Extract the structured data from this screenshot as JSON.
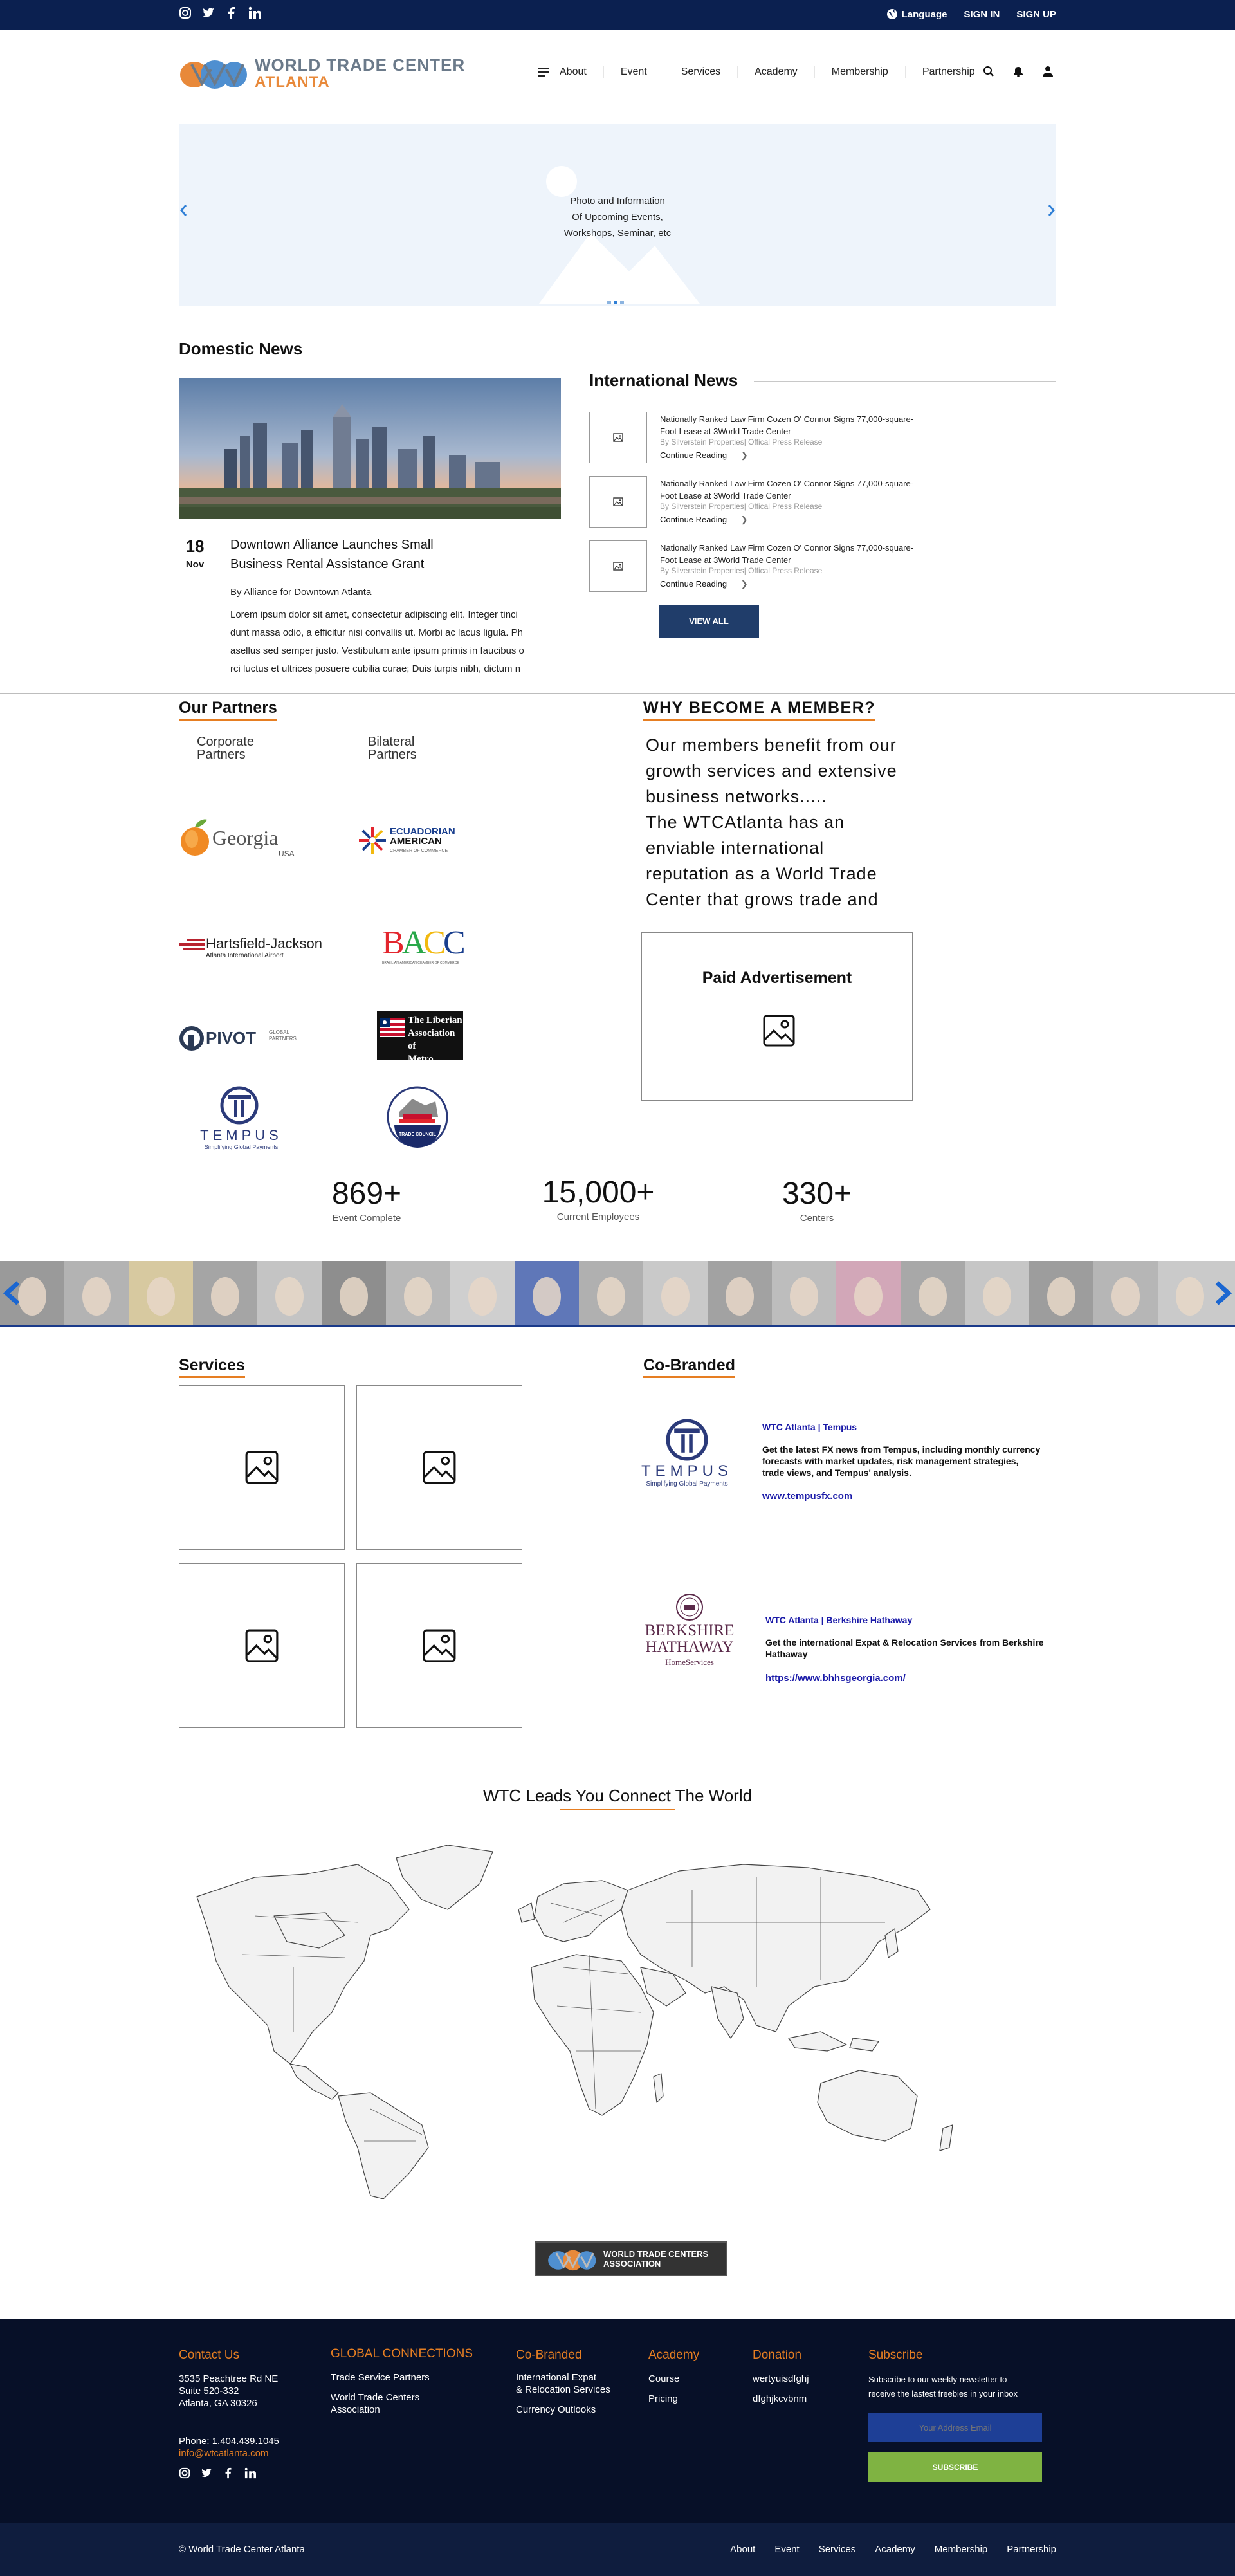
{
  "topbar": {
    "social": [
      "instagram-icon",
      "twitter-icon",
      "facebook-icon",
      "linkedin-icon"
    ],
    "language": "Language",
    "signin": "SIGN IN",
    "signup": "SIGN UP"
  },
  "brand": {
    "line1": "WORLD TRADE CENTER",
    "line2": "ATLANTA"
  },
  "nav": {
    "items": [
      "About",
      "Event",
      "Services",
      "Academy",
      "Membership",
      "Partnership"
    ]
  },
  "hero": {
    "line1": "Photo and Information",
    "line2": "Of Upcoming Events,",
    "line3": "Workshops, Seminar, etc"
  },
  "domestic": {
    "title": "Domestic News",
    "day": "18",
    "month": "Nov",
    "headline1": "Downtown Alliance Launches Small",
    "headline2": "Business Rental Assistance Grant",
    "author": "By Alliance for Downtown Atlanta",
    "body1": "Lorem ipsum dolor sit amet, consectetur adipiscing elit. Integer tinci",
    "body2": "dunt massa odio, a efficitur nisi convallis ut. Morbi ac lacus ligula. Ph",
    "body3": "asellus sed semper justo. Vestibulum ante ipsum primis in faucibus o",
    "body4": "rci luctus et ultrices posuere cubilia curae; Duis turpis nibh, dictum n"
  },
  "international": {
    "title": "International News",
    "items": [
      {
        "t1": "Nationally Ranked Law Firm Cozen O' Connor Signs 77,000-square-",
        "t2": "Foot Lease at 3World Trade Center",
        "src": "By Silverstein Properties|  Offical Press Release",
        "more": "Continue Reading"
      },
      {
        "t1": "Nationally Ranked Law Firm Cozen O' Connor Signs 77,000-square-",
        "t2": "Foot Lease at 3World Trade Center",
        "src": "By Silverstein Properties|  Offical Press Release",
        "more": "Continue Reading"
      },
      {
        "t1": "Nationally Ranked Law Firm Cozen O' Connor Signs 77,000-square-",
        "t2": "Foot Lease at 3World Trade Center",
        "src": "By Silverstein Properties|  Offical Press Release",
        "more": "Continue Reading"
      }
    ],
    "view_all": "VIEW ALL"
  },
  "partners": {
    "title": "Our Partners",
    "col1a": "Corporate",
    "col1b": "Partners",
    "col2a": "Bilateral",
    "col2b": "Partners",
    "logos": {
      "georgia": "Georgia",
      "georgia_sub": "USA",
      "ecuador1": "ECUADORIAN",
      "ecuador2": "AMERICAN",
      "ecuador3": "CHAMBER OF COMMERCE",
      "hartsfield1": "Hartsfield-Jackson",
      "hartsfield2": "Atlanta International Airport",
      "bacc": "BACC",
      "bacc_sub": "BRAZILIAN-AMERICAN CHAMBER OF COMMERCE",
      "pivot": "PIVOT",
      "pivot_sub": "GLOBAL PARTNERS",
      "liberian1": "The Liberian",
      "liberian2": "Association of",
      "liberian3": "Metro Atlanta",
      "tempus": "TEMPUS",
      "tempus_sub": "Simplifying Global Payments",
      "usa_council": "TRADE COUNCIL"
    }
  },
  "member": {
    "title": "WHY BECOME A MEMBER?",
    "lines": [
      "Our members benefit from our",
      "growth services and extensive",
      "business networks.....",
      "The WTCAtlanta has an",
      "enviable international",
      "reputation as a World Trade",
      "Center that grows trade and"
    ],
    "ad": "Paid Advertisement"
  },
  "stats": [
    {
      "num": "869+",
      "label": "Event Complete"
    },
    {
      "num": "15,000+",
      "label": "Current Employees"
    },
    {
      "num": "330+",
      "label": "Centers"
    }
  ],
  "services": {
    "title": "Services"
  },
  "cobranded": {
    "title": "Co-Branded",
    "items": [
      {
        "link": "WTC Atlanta | Tempus",
        "d1": "Get the latest FX news from Tempus, including monthly currency",
        "d2": "forecasts with market updates, risk management strategies,",
        "d3": "trade views, and Tempus' analysis.",
        "url": "www.tempusfx.com",
        "logo1": "TEMPUS",
        "logo2": "Simplifying Global Payments"
      },
      {
        "link": "WTC Atlanta | Berkshire Hathaway",
        "d1": "Get the international Expat & Relocation Services from Berkshire",
        "d2": "Hathaway",
        "d3": "",
        "url": "https://www.bhhsgeorgia.com/",
        "logo1": "BERKSHIRE",
        "logo2": "HATHAWAY",
        "logo3": "HomeServices"
      }
    ]
  },
  "world": {
    "title": "WTC Leads You Connect The World",
    "badge1": "WORLD TRADE CENTERS",
    "badge2": "ASSOCIATION"
  },
  "footer": {
    "contact": {
      "title": "Contact Us",
      "l1": "3535 Peachtree Rd NE",
      "l2": "Suite 520-332",
      "l3": "Atlanta, GA 30326",
      "phone": "Phone: 1.404.439.1045",
      "email": "info@wtcatlanta.com"
    },
    "global": {
      "title": "GLOBAL CONNECTIONS",
      "i1": "Trade Service Partners",
      "i2a": "World Trade Centers",
      "i2b": "Association"
    },
    "cob": {
      "title": "Co-Branded",
      "i1a": "International Expat",
      "i1b": "& Relocation Services",
      "i2": "Currency Outlooks"
    },
    "academy": {
      "title": "Academy",
      "i1": "Course",
      "i2": "Pricing"
    },
    "donation": {
      "title": "Donation",
      "i1": "wertyuisdfghj",
      "i2": "dfghjkcvbnm"
    },
    "subscribe": {
      "title": "Subscribe",
      "d1": "Subscribe to our weekly newsletter to",
      "d2": "receive the lastest freebies in your inbox",
      "placeholder": "Your Address Email",
      "button": "SUBSCRIBE"
    }
  },
  "bottom": {
    "copyright": "© World Trade Center Atlanta",
    "links": [
      "About",
      "Event",
      "Services",
      "Academy",
      "Membership",
      "Partnership"
    ]
  },
  "colors": {
    "navy": "#0b2050",
    "orange": "#e67e22",
    "green": "#7fb342",
    "blue": "#2f7fd6"
  }
}
